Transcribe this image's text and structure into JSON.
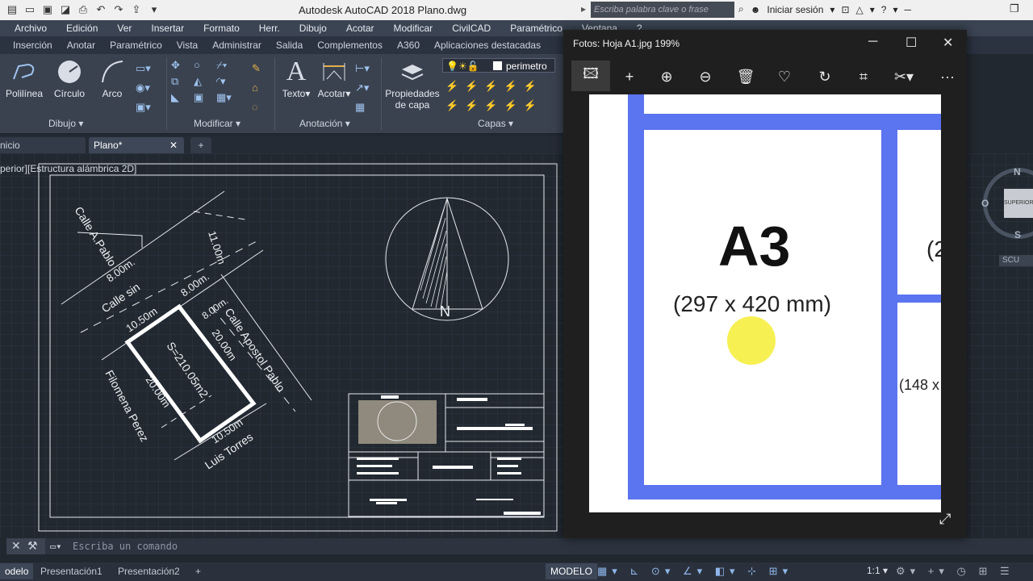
{
  "title_bar": {
    "app_title": "Autodesk AutoCAD 2018    Plano.dwg",
    "search_placeholder": "Escriba palabra clave o frase",
    "signin": "Iniciar sesión"
  },
  "menu": [
    "Archivo",
    "Edición",
    "Ver",
    "Insertar",
    "Formato",
    "Herr.",
    "Dibujo",
    "Acotar",
    "Modificar",
    "CivilCAD",
    "Paramétrico",
    "Ventana",
    "?"
  ],
  "ribbon_tabs": [
    "Inserción",
    "Anotar",
    "Paramétrico",
    "Vista",
    "Administrar",
    "Salida",
    "Complementos",
    "A360",
    "Aplicaciones destacadas"
  ],
  "ribbon": {
    "dibujo": {
      "polilinea": "Polilínea",
      "circulo": "Círculo",
      "arco": "Arco",
      "label": "Dibujo"
    },
    "modificar_label": "Modificar",
    "anotacion": {
      "texto": "Texto",
      "acotar": "Acotar",
      "label": "Anotación"
    },
    "capas": {
      "propiedades_line1": "Propiedades",
      "propiedades_line2": "de capa",
      "layer_name": "perimetro",
      "label": "Capas"
    }
  },
  "doc_tabs": {
    "start": "nicio",
    "plano": "Plano*"
  },
  "viewport_label": "perior][Estructura alámbrica 2D]",
  "drawing": {
    "street_a_pablo": "Calle A.Pablo",
    "street_sin": "Calle sin",
    "street_apostol": "Calle Apostol Pablo",
    "dim_11": "11.00m",
    "dim_8a": "8.00m.",
    "dim_8b": "8.00m.",
    "dim_8c": "8.00m.",
    "dim_1050a": "10.50m",
    "dim_1050b": "10.50m",
    "dim_20a": "20.00m",
    "dim_20b": "20.00m",
    "area": "S=210.05m2",
    "owner_left": "Filomena Perez",
    "owner_bottom": "Luis Torres",
    "north": "N"
  },
  "viewcube": {
    "face": "SUPERIOR",
    "n": "N",
    "s": "S",
    "o": "O",
    "ucs": "SCU"
  },
  "command_placeholder": "Escriba un comando",
  "layout_tabs": {
    "model": "odelo",
    "p1": "Presentación1",
    "p2": "Presentación2"
  },
  "status": {
    "model": "MODELO",
    "scale": "1:1"
  },
  "photo_viewer": {
    "title": "Fotos: Hoja A1.jpg   199%",
    "sheet_name": "A3",
    "sheet_size": "(297 x 420 mm)",
    "partial_a": "(2",
    "partial_b": "(148 x"
  },
  "colors": {
    "sheet_border": "#5b74ef",
    "highlight": "#f7f053",
    "canvas": "#212830"
  }
}
